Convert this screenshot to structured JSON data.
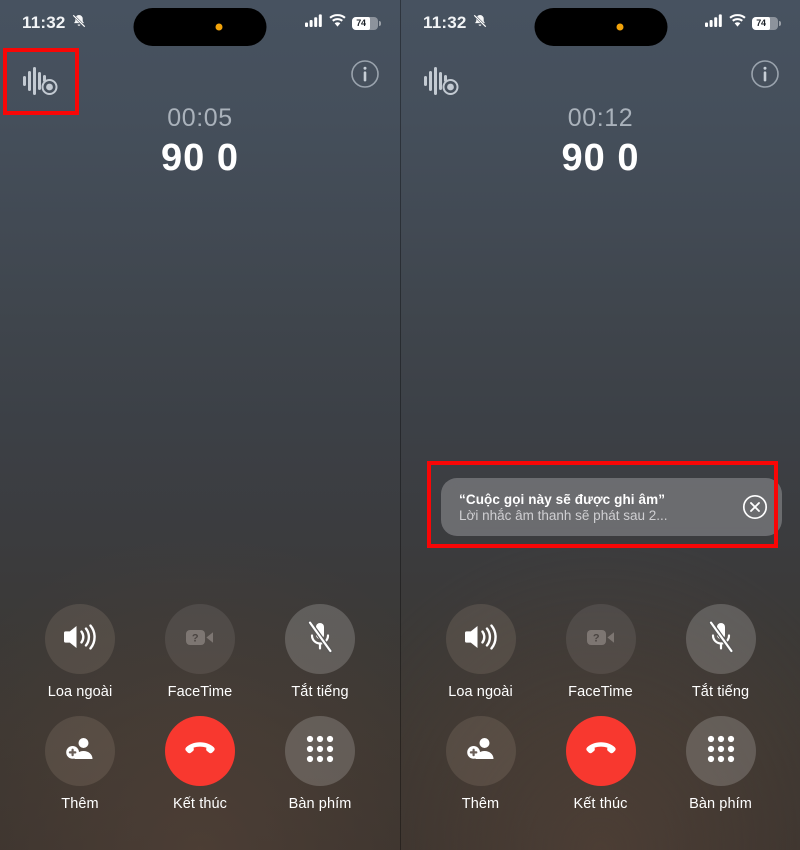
{
  "panels": [
    {
      "id": "left",
      "status": {
        "time": "11:32",
        "silent_icon": "bell-slash-icon",
        "signal_icon": "cellular-signal-icon",
        "wifi_icon": "wifi-icon",
        "battery_level": "74"
      },
      "record_indicator_icon": "call-recording-waveform-icon",
      "info_icon": "info-circle-icon",
      "call": {
        "duration": "00:05",
        "number": "90 0"
      },
      "banner": null,
      "buttons": [
        {
          "name": "speaker",
          "label": "Loa ngoài",
          "icon": "speaker-wave-icon",
          "state": "active"
        },
        {
          "name": "facetime",
          "label": "FaceTime",
          "icon": "video-camera-question-icon",
          "state": "disabled"
        },
        {
          "name": "mute",
          "label": "Tắt tiếng",
          "icon": "microphone-slash-icon",
          "state": "normal"
        },
        {
          "name": "add-call",
          "label": "Thêm",
          "icon": "person-add-icon",
          "state": "normal"
        },
        {
          "name": "end-call",
          "label": "Kết thúc",
          "icon": "phone-down-icon",
          "state": "end"
        },
        {
          "name": "keypad",
          "label": "Bàn phím",
          "icon": "dialpad-grid-icon",
          "state": "normal"
        }
      ]
    },
    {
      "id": "right",
      "status": {
        "time": "11:32",
        "silent_icon": "bell-slash-icon",
        "signal_icon": "cellular-signal-icon",
        "wifi_icon": "wifi-icon",
        "battery_level": "74"
      },
      "record_indicator_icon": "call-recording-waveform-icon",
      "info_icon": "info-circle-icon",
      "call": {
        "duration": "00:12",
        "number": "90 0"
      },
      "banner": {
        "title": "“Cuộc gọi này sẽ được ghi âm”",
        "subtitle": "Lời nhắc âm thanh sẽ phát sau 2...",
        "close_icon": "close-circle-icon"
      },
      "buttons": [
        {
          "name": "speaker",
          "label": "Loa ngoài",
          "icon": "speaker-wave-icon",
          "state": "active"
        },
        {
          "name": "facetime",
          "label": "FaceTime",
          "icon": "video-camera-question-icon",
          "state": "disabled"
        },
        {
          "name": "mute",
          "label": "Tắt tiếng",
          "icon": "microphone-slash-icon",
          "state": "normal"
        },
        {
          "name": "add-call",
          "label": "Thêm",
          "icon": "person-add-icon",
          "state": "normal"
        },
        {
          "name": "end-call",
          "label": "Kết thúc",
          "icon": "phone-down-icon",
          "state": "end"
        },
        {
          "name": "keypad",
          "label": "Bàn phím",
          "icon": "dialpad-grid-icon",
          "state": "normal"
        }
      ]
    }
  ],
  "annotations": {
    "highlight_color": "#f90606",
    "boxes": [
      {
        "name": "record-indicator-highlight",
        "target": "call-recording-waveform-icon"
      },
      {
        "name": "recording-banner-highlight",
        "target": "recording-notification-banner"
      }
    ]
  }
}
